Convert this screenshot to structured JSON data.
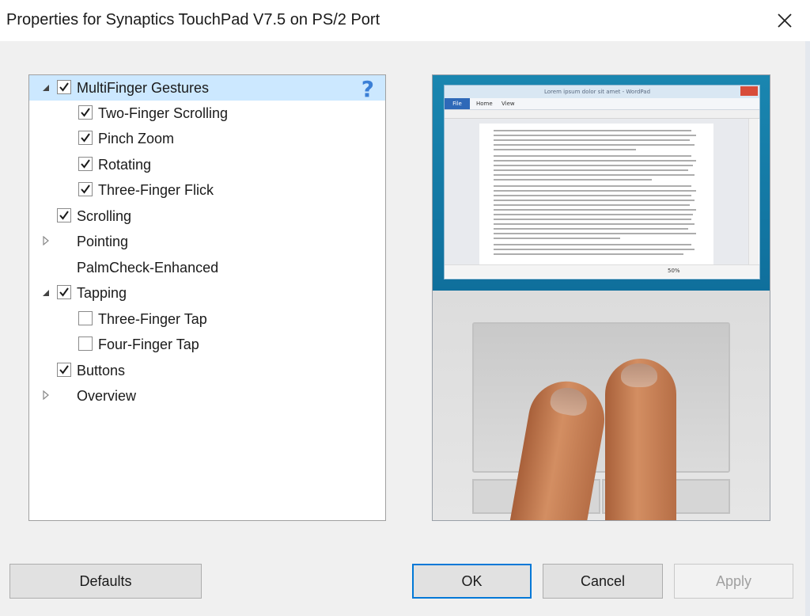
{
  "window": {
    "title": "Properties for Synaptics TouchPad V7.5 on PS/2 Port"
  },
  "tree": {
    "items": [
      {
        "label": "MultiFinger Gestures",
        "checked": true,
        "expander": "expanded",
        "selected": true
      },
      {
        "label": "Two-Finger Scrolling",
        "checked": true
      },
      {
        "label": "Pinch Zoom",
        "checked": true
      },
      {
        "label": "Rotating",
        "checked": true
      },
      {
        "label": "Three-Finger Flick",
        "checked": true
      },
      {
        "label": "Scrolling",
        "checked": true
      },
      {
        "label": "Pointing",
        "expander": "collapsed"
      },
      {
        "label": "PalmCheck-Enhanced"
      },
      {
        "label": "Tapping",
        "checked": true,
        "expander": "expanded"
      },
      {
        "label": "Three-Finger Tap",
        "checked": false
      },
      {
        "label": "Four-Finger Tap",
        "checked": false
      },
      {
        "label": "Buttons",
        "checked": true
      },
      {
        "label": "Overview",
        "expander": "collapsed"
      }
    ],
    "help_symbol": "?"
  },
  "preview": {
    "wordpad_title": "Lorem ipsum dolor sit amet - WordPad",
    "file_tab": "File",
    "home_tab": "Home",
    "view_tab": "View",
    "zoom": "50%"
  },
  "buttons": {
    "defaults": "Defaults",
    "ok": "OK",
    "cancel": "Cancel",
    "apply": "Apply"
  },
  "colors": {
    "selection": "#cce8ff",
    "help_icon": "#3b7fd6",
    "ok_border": "#0078d7",
    "check_mark": "#1a1a1a"
  }
}
